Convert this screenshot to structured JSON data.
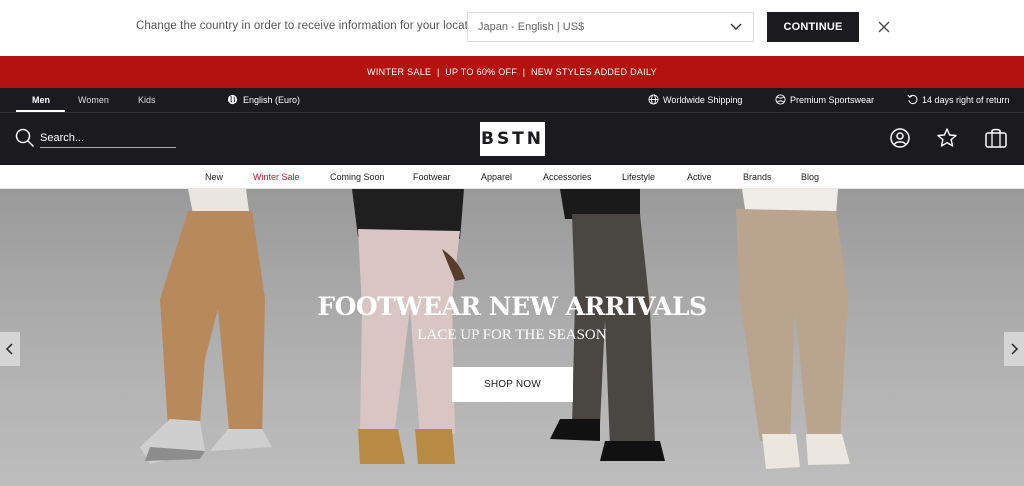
{
  "country_bar": {
    "message": "Change the country in order to receive information for your location.",
    "selected_country": "Japan - English | US$",
    "continue_label": "CONTINUE"
  },
  "promo": {
    "text": "WINTER SALE  |  UP TO 60% OFF  |  NEW STYLES ADDED DAILY"
  },
  "utility": {
    "genders": [
      "Men",
      "Women",
      "Kids"
    ],
    "active_gender": "Men",
    "language": "English (Euro)",
    "usps": [
      "Worldwide Shipping",
      "Premium Sportswear",
      "14 days right of return"
    ]
  },
  "header": {
    "search_placeholder": "Search...",
    "logo": "BSTN"
  },
  "nav": {
    "items": [
      "New",
      "Winter Sale",
      "Coming Soon",
      "Footwear",
      "Apparel",
      "Accessories",
      "Lifestyle",
      "Active",
      "Brands",
      "Blog"
    ]
  },
  "hero": {
    "title": "FOOTWEAR NEW ARRIVALS",
    "subtitle": "LACE UP FOR THE SEASON",
    "cta": "SHOP NOW"
  },
  "colors": {
    "dark": "#1b1a1f",
    "promo_red": "#b3120f",
    "sale_red": "#c8102e"
  }
}
